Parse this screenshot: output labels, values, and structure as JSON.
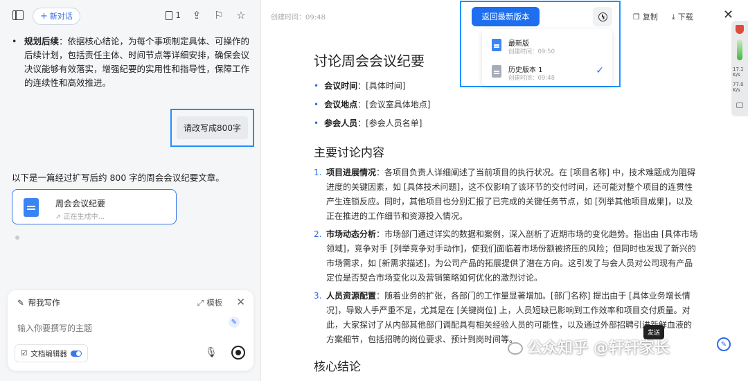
{
  "left": {
    "new_chat_label": "新对话",
    "doc_count": "1",
    "bullet_bold": "规划后续",
    "bullet_text": "：依据核心结论，为每个事项制定具体、可操作的后续计划，包括责任主体、时间节点等详细安排，确保会议决议能够有效落实，增强纪要的实用性和指导性，保障工作的连续性和高效推进。",
    "user_message": "请改写成800字",
    "ai_reply": "以下是一篇经过扩写后约 800 字的周会会议纪要文章。",
    "doc_card": {
      "title": "周会会议纪要",
      "status": "正在生成中..."
    },
    "writer": {
      "title": "帮我写作",
      "template_label": "模板",
      "placeholder": "输入你要撰写的主题",
      "editor_label": "文档编辑器"
    }
  },
  "right": {
    "created_time": "创建时间：09:48",
    "return_button": "返回最新版本",
    "versions": [
      {
        "name": "最新版",
        "time": "创建时间：09:50"
      },
      {
        "name": "历史版本 1",
        "time": "创建时间：09:48"
      }
    ],
    "copy_label": "复制",
    "download_label": "下载",
    "doc": {
      "title": "讨论周会会议纪要",
      "meta": [
        {
          "label": "会议时间",
          "value": "：[具体时间]"
        },
        {
          "label": "会议地点",
          "value": "：[会议室具体地点]"
        },
        {
          "label": "参会人员",
          "value": "：[参会人员名单]"
        }
      ],
      "section1": "主要讨论内容",
      "items": [
        {
          "num": "1.",
          "label": "项目进展情况",
          "text": "：各项目负责人详细阐述了当前项目的执行状况。在 [项目名称] 中，技术难题成为阻碍进度的关键因素，如 [具体技术问题]，这不仅影响了该环节的交付时间，还可能对整个项目的连贯性产生连锁反应。同时，其他项目也分别汇报了已完成的关键任务节点，如 [列举其他项目成果]，以及正在推进的工作细节和资源投入情况。"
        },
        {
          "num": "2.",
          "label": "市场动态分析",
          "text": "：市场部门通过详实的数据和案例，深入剖析了近期市场的变化趋势。指出由 [具体市场领域]，竞争对手 [列举竞争对手动作]，使我们面临着市场份额被挤压的风险；但同时也发现了新兴的市场需求，如 [新需求描述]，为公司产品的拓展提供了潜在方向。这引发了与会人员对公司现有产品定位是否契合市场变化以及营销策略如何优化的激烈讨论。"
        },
        {
          "num": "3.",
          "label": "人员资源配置",
          "text": "：随着业务的扩张，各部门的工作量显著增加。[部门名称] 提出由于 [具体业务增长情况]，导致人手严重不足，尤其是在 [关键岗位] 上，人员短缺已影响到工作效率和项目交付质量。对此，大家探讨了从内部其他部门调配具有相关经验人员的可能性，以及通过外部招聘引进新鲜血液的方案细节，包括招聘的岗位要求、预计到岗时间等。"
        }
      ],
      "section2": "核心结论"
    },
    "tooltip": "发送",
    "watermark": "公众知乎 @轩轩家长",
    "side": {
      "s1": "17.1\nK/s",
      "s2": "77.0\nK/s"
    }
  }
}
